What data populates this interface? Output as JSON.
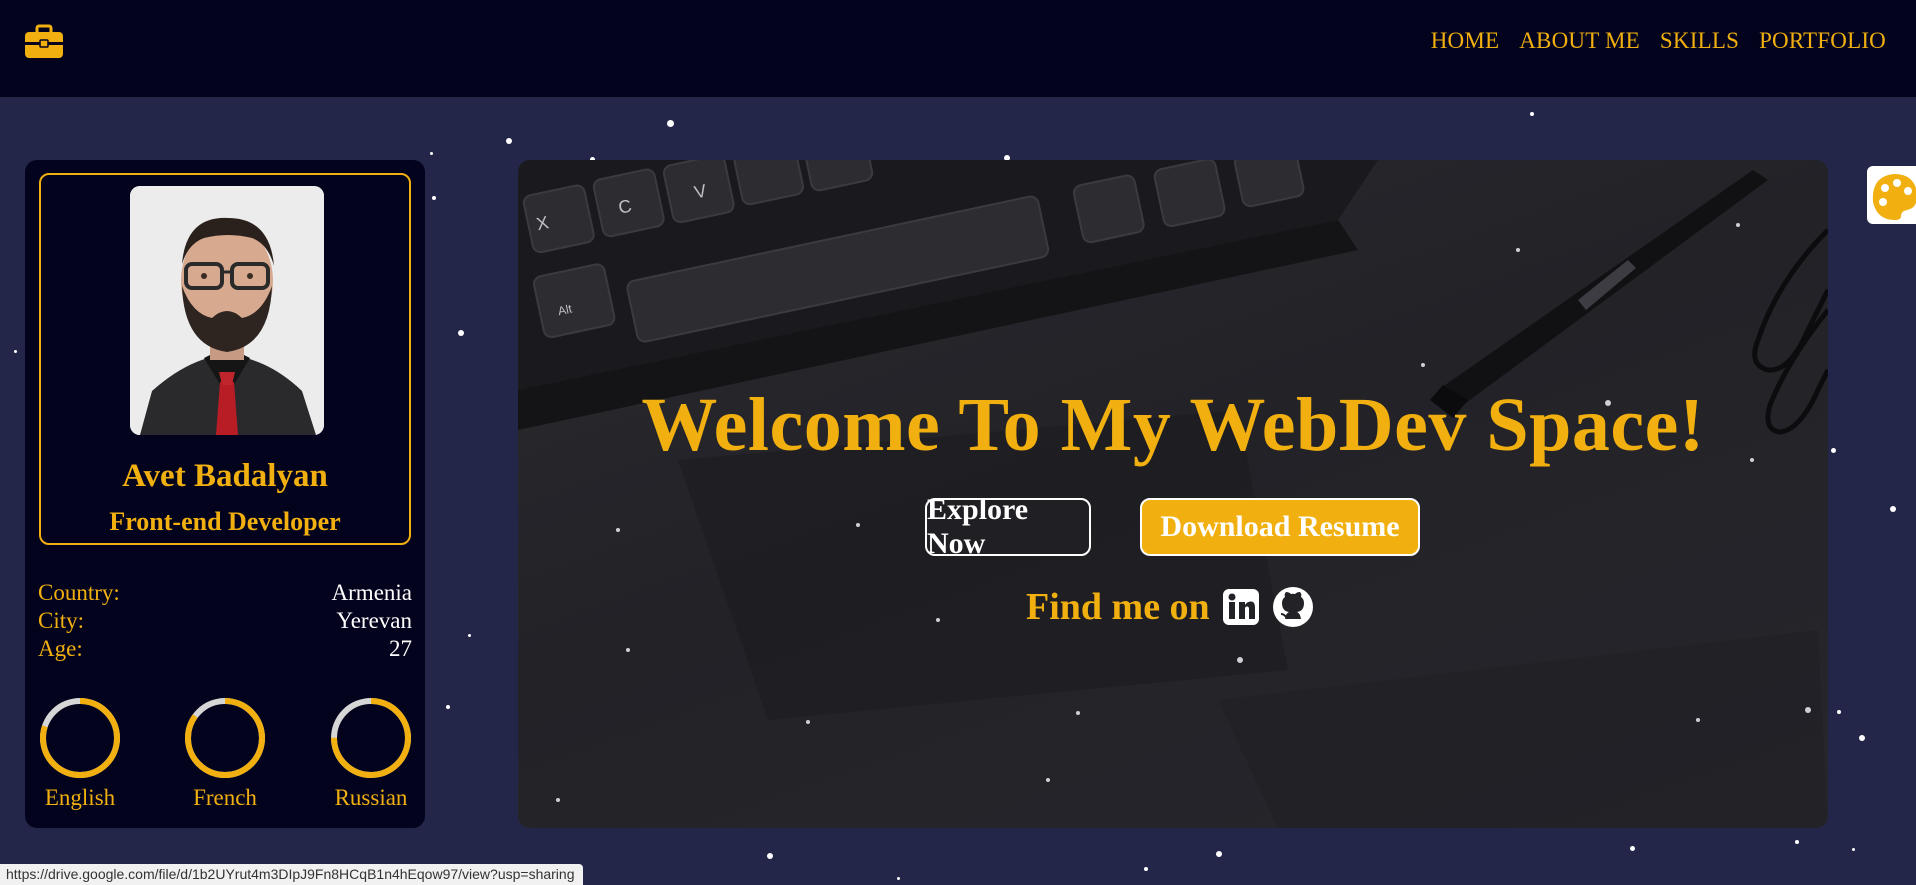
{
  "nav": {
    "brand_icon": "briefcase-icon",
    "items": [
      "HOME",
      "ABOUT ME",
      "SKILLS",
      "PORTFOLIO"
    ]
  },
  "profile": {
    "name": "Avet Badalyan",
    "role": "Front-end Developer",
    "info": [
      {
        "key": "Country:",
        "value": "Armenia"
      },
      {
        "key": "City:",
        "value": "Yerevan"
      },
      {
        "key": "Age:",
        "value": "27"
      }
    ],
    "languages": [
      {
        "label": "English",
        "level": 0.8
      },
      {
        "label": "French",
        "level": 0.85
      },
      {
        "label": "Russian",
        "level": 0.75
      }
    ]
  },
  "hero": {
    "title": "Welcome To My WebDev Space!",
    "explore_label": "Explore Now",
    "resume_label": "Download Resume",
    "findme_label": "Find me on",
    "social_icons": [
      "linkedin-icon",
      "github-icon"
    ]
  },
  "palette_icon": "palette-icon",
  "status_url": "https://drive.google.com/file/d/1b2UYrut4m3DIpJ9Fn8HCqB1n4hEqow97/view?usp=sharing",
  "colors": {
    "accent": "#f1b00f",
    "navbar": "#03031d",
    "background": "#232649",
    "card": "#03031d"
  }
}
